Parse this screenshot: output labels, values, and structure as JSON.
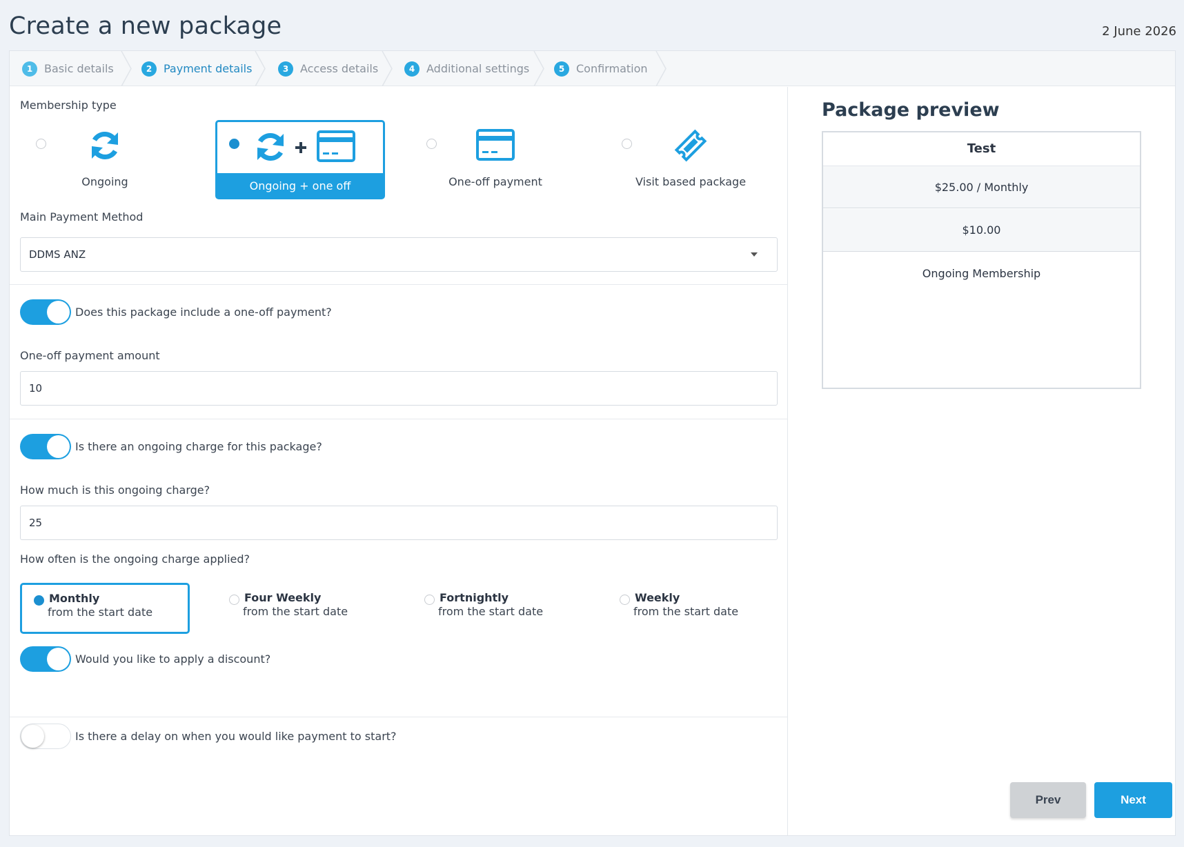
{
  "header": {
    "title": "Create a new package",
    "date": "2 June 2026"
  },
  "steps": [
    {
      "num": "1",
      "label": "Basic details"
    },
    {
      "num": "2",
      "label": "Payment details"
    },
    {
      "num": "3",
      "label": "Access details"
    },
    {
      "num": "4",
      "label": "Additional settings"
    },
    {
      "num": "5",
      "label": "Confirmation"
    }
  ],
  "form": {
    "membership_type_label": "Membership type",
    "membership_types": [
      {
        "label": "Ongoing",
        "icon": "sync-icon",
        "selected": false
      },
      {
        "label": "Ongoing + one off",
        "icon": "sync-plus-card-icon",
        "selected": true
      },
      {
        "label": "One-off payment",
        "icon": "credit-card-icon",
        "selected": false
      },
      {
        "label": "Visit based package",
        "icon": "ticket-icon",
        "selected": false
      }
    ],
    "main_payment_label": "Main Payment Method",
    "main_payment_value": "DDMS ANZ",
    "one_off_toggle_label": "Does this package include a one-off payment?",
    "one_off_toggle_on": true,
    "one_off_amount_label": "One-off payment amount",
    "one_off_amount_value": "10",
    "ongoing_toggle_label": "Is there an ongoing charge for this package?",
    "ongoing_toggle_on": true,
    "ongoing_amount_label": "How much is this ongoing charge?",
    "ongoing_amount_value": "25",
    "frequency_label": "How often is the ongoing charge applied?",
    "frequencies": [
      {
        "title": "Monthly",
        "sub": "from the start date",
        "selected": true
      },
      {
        "title": "Four Weekly",
        "sub": "from the start date",
        "selected": false
      },
      {
        "title": "Fortnightly",
        "sub": "from the start date",
        "selected": false
      },
      {
        "title": "Weekly",
        "sub": "from the start date",
        "selected": false
      }
    ],
    "discount_toggle_label": "Would you like to apply a discount?",
    "discount_toggle_on": true,
    "delay_toggle_label": "Is there a delay on when you would like payment to start?",
    "delay_toggle_on": false
  },
  "preview": {
    "title": "Package preview",
    "name": "Test",
    "ongoing_price": "$25.00 / Monthly",
    "one_off_price": "$10.00",
    "type": "Ongoing Membership"
  },
  "buttons": {
    "prev": "Prev",
    "next": "Next"
  },
  "colors": {
    "accent": "#1d9fe0",
    "text": "#2c3e50",
    "prev_bg": "#cfd2d5"
  }
}
